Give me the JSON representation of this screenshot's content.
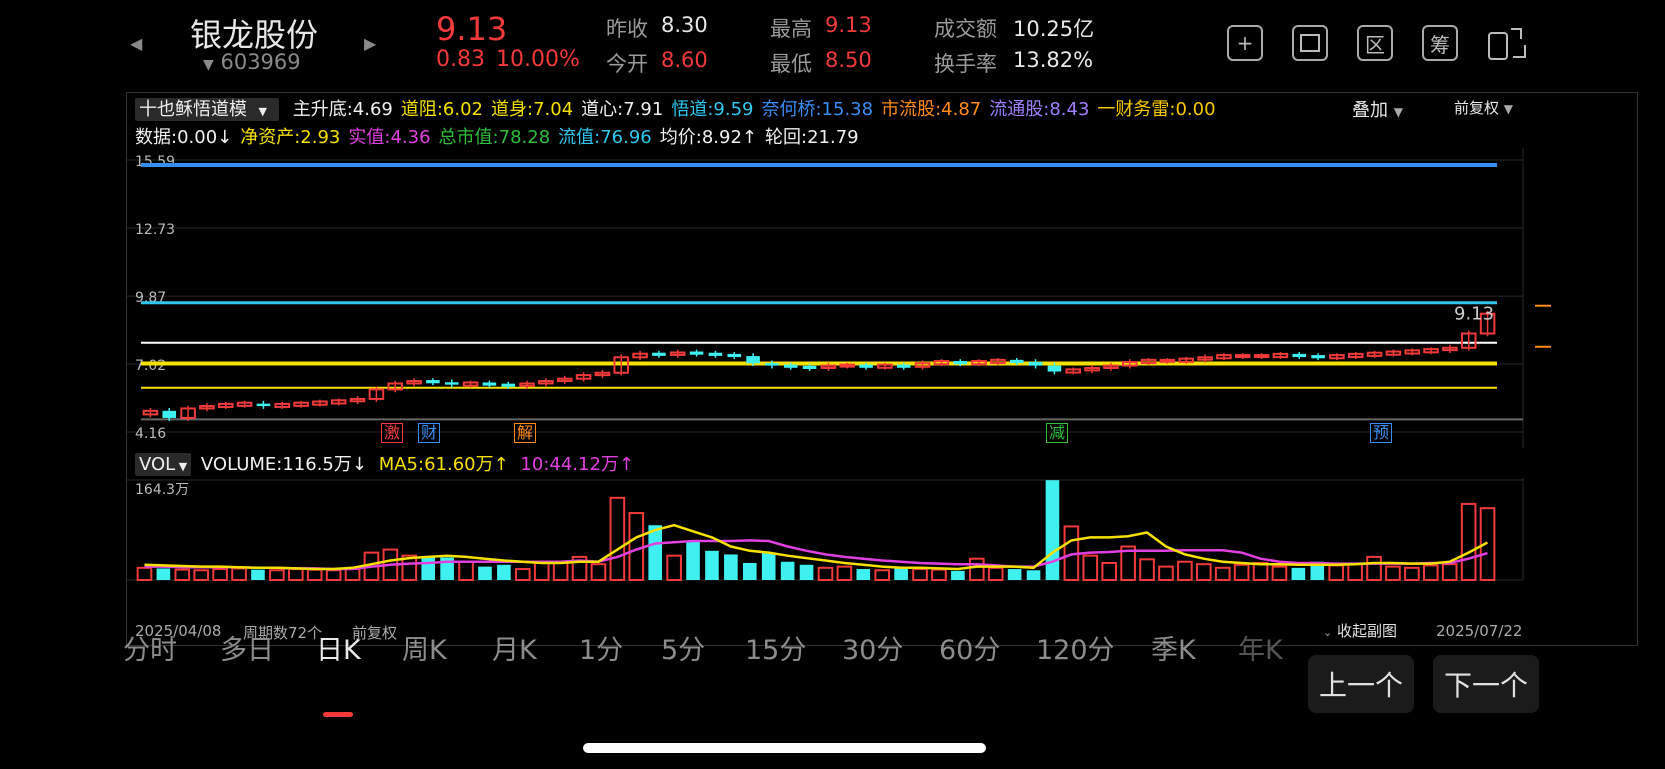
{
  "header": {
    "name": "银龙股份",
    "code": "603969",
    "price": "9.13",
    "change": "0.83",
    "change_pct": "10.00%",
    "stats": {
      "prev_close_label": "昨收",
      "prev_close": "8.30",
      "open_label": "今开",
      "open": "8.60",
      "high_label": "最高",
      "high": "9.13",
      "low_label": "最低",
      "low": "8.50",
      "turnover_label": "成交额",
      "turnover": "10.25亿",
      "turnover_rate_label": "换手率",
      "turnover_rate": "13.82%"
    },
    "icons": [
      "plus-icon",
      "frame-icon",
      "range-icon",
      "chip-icon",
      "switch-device-icon"
    ],
    "icon_glyphs": {
      "range": "区",
      "chip": "筹"
    }
  },
  "indicator": {
    "selector": "十也稣悟道模",
    "row1": [
      {
        "text": "主升底:4.69",
        "color": "#f0f0f0"
      },
      {
        "text": "道阻:6.02",
        "color": "#f5e000"
      },
      {
        "text": "道身:7.04",
        "color": "#f5e000"
      },
      {
        "text": "道心:7.91",
        "color": "#f0f0f0"
      },
      {
        "text": "悟道:9.59",
        "color": "#2fc7f0"
      },
      {
        "text": "奈何桥:15.38",
        "color": "#3a8df5"
      },
      {
        "text": "市流股:4.87",
        "color": "#ff8c1a"
      },
      {
        "text": "流通股:8.43",
        "color": "#9e80ff"
      },
      {
        "text": "一财务雷:0.00",
        "color": "#f5c800"
      }
    ],
    "row2": [
      {
        "text": "数据:0.00↓",
        "color": "#f0f0f0"
      },
      {
        "text": "净资产:2.93",
        "color": "#f5e000"
      },
      {
        "text": "实值:4.36",
        "color": "#e040e0"
      },
      {
        "text": "总市值:78.28",
        "color": "#2fbf3a"
      },
      {
        "text": "流值:76.96",
        "color": "#2fc7f0"
      },
      {
        "text": "均价:8.92↑",
        "color": "#f0f0f0"
      },
      {
        "text": "轮回:21.79",
        "color": "#f0f0f0"
      }
    ],
    "overlay": "叠加",
    "adjust": "前复权"
  },
  "price_axis": {
    "labels": [
      "15.59",
      "12.73",
      "9.87",
      "7.02",
      "4.16"
    ],
    "last_price": "9.13"
  },
  "event_tags": [
    {
      "text": "激",
      "color": "#f23a3a"
    },
    {
      "text": "财",
      "color": "#3a8df5"
    },
    {
      "text": "解",
      "color": "#ff8c1a"
    },
    {
      "text": "减",
      "color": "#2fbf3a"
    },
    {
      "text": "预",
      "color": "#3a8df5"
    }
  ],
  "volume": {
    "selector": "VOL",
    "volume_label": "VOLUME:116.5万↓",
    "ma5_label": "MA5:61.60万↑",
    "ma10_label": "10:44.12万↑",
    "max_label": "164.3万"
  },
  "footer": {
    "start_date": "2025/04/08",
    "period_count": "周期数72个",
    "adjust": "前复权",
    "collapse": "收起副图",
    "end_date": "2025/07/22"
  },
  "tabs": [
    "分时",
    "多日",
    "日K",
    "周K",
    "月K",
    "1分",
    "5分",
    "15分",
    "30分",
    "60分",
    "120分",
    "季K",
    "年K"
  ],
  "active_tab": "日K",
  "nav": {
    "prev": "上一个",
    "next": "下一个"
  },
  "chart_data": {
    "type": "candlestick",
    "x_range": [
      "2025/04/08",
      "2025/07/22"
    ],
    "ylim": [
      4.16,
      15.59
    ],
    "levels": {
      "奈何桥": 15.38,
      "悟道": 9.59,
      "道心": 7.91,
      "道身": 7.04,
      "道阻": 6.02
    },
    "closes": [
      5.05,
      4.75,
      5.15,
      5.25,
      5.3,
      5.35,
      5.25,
      5.3,
      5.35,
      5.4,
      5.45,
      5.55,
      5.95,
      6.2,
      6.3,
      6.25,
      6.15,
      6.2,
      6.15,
      6.1,
      6.2,
      6.3,
      6.4,
      6.55,
      6.65,
      7.3,
      7.45,
      7.4,
      7.5,
      7.45,
      7.4,
      7.35,
      7.05,
      6.95,
      6.9,
      6.85,
      6.95,
      6.95,
      6.9,
      6.95,
      6.9,
      7.05,
      7.1,
      7.05,
      7.1,
      7.15,
      7.1,
      6.95,
      6.7,
      6.75,
      6.85,
      6.95,
      7.1,
      7.15,
      7.15,
      7.2,
      7.3,
      7.35,
      7.35,
      7.35,
      7.4,
      7.35,
      7.3,
      7.35,
      7.4,
      7.45,
      7.5,
      7.55,
      7.6,
      7.7,
      8.3,
      9.13
    ],
    "volume_max": 164.3,
    "volume": [
      20,
      19,
      17,
      16,
      18,
      19,
      17,
      16,
      18,
      17,
      16,
      18,
      45,
      50,
      40,
      38,
      37,
      30,
      22,
      25,
      18,
      28,
      30,
      38,
      26,
      135,
      110,
      90,
      40,
      65,
      48,
      42,
      28,
      45,
      30,
      25,
      20,
      22,
      18,
      16,
      20,
      18,
      17,
      15,
      35,
      20,
      18,
      16,
      164,
      88,
      40,
      28,
      55,
      34,
      22,
      30,
      26,
      20,
      25,
      28,
      22,
      20,
      30,
      24,
      26,
      38,
      22,
      20,
      24,
      26,
      125,
      118
    ],
    "ma5": [
      25,
      24,
      23,
      22,
      22,
      21,
      20,
      20,
      19,
      18,
      18,
      20,
      26,
      32,
      36,
      38,
      40,
      38,
      35,
      32,
      30,
      28,
      28,
      30,
      30,
      50,
      70,
      82,
      90,
      80,
      70,
      55,
      48,
      45,
      40,
      36,
      32,
      28,
      25,
      22,
      20,
      20,
      19,
      18,
      22,
      22,
      22,
      20,
      45,
      65,
      70,
      70,
      72,
      78,
      55,
      42,
      35,
      30,
      28,
      26,
      26,
      25,
      25,
      25,
      26,
      28,
      28,
      27,
      27,
      30,
      45,
      61.6
    ],
    "ma10": [
      22,
      22,
      21,
      21,
      21,
      21,
      20,
      20,
      19,
      19,
      18,
      18,
      22,
      25,
      27,
      28,
      30,
      30,
      30,
      30,
      30,
      30,
      30,
      32,
      30,
      38,
      50,
      60,
      62,
      64,
      64,
      64,
      65,
      64,
      55,
      48,
      42,
      38,
      35,
      32,
      30,
      28,
      27,
      26,
      26,
      24,
      22,
      22,
      30,
      42,
      45,
      46,
      48,
      48,
      48,
      49,
      49,
      49,
      45,
      35,
      30,
      28,
      28,
      27,
      27,
      27,
      27,
      27,
      28,
      28,
      35,
      44.12
    ]
  }
}
